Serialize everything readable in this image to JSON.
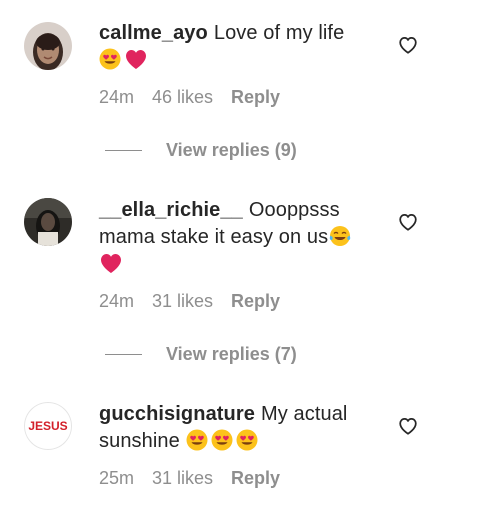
{
  "comments": [
    {
      "username": "callme_ayo",
      "text": "Love of my life",
      "time": "24m",
      "likes": "46 likes",
      "reply_label": "Reply",
      "view_replies": "View replies (9)"
    },
    {
      "username": "__ella_richie__",
      "text": "Oooppsss mama stake it easy on us",
      "time": "24m",
      "likes": "31 likes",
      "reply_label": "Reply",
      "view_replies": "View replies (7)"
    },
    {
      "username": "gucchisignature",
      "text": "My actual sunshine",
      "time": "25m",
      "likes": "31 likes",
      "reply_label": "Reply"
    }
  ],
  "avatar_text": {
    "gucchisignature": "JESUS"
  },
  "icons": {
    "like": "heart-outline-icon",
    "heart_eyes": "heart-eyes-emoji",
    "red_heart": "red-heart-emoji",
    "laughing": "tears-of-joy-emoji"
  },
  "colors": {
    "text": "#262626",
    "secondary": "#8e8e8e",
    "heart": "#e0245e",
    "emoji_yellow": "#fcc21b",
    "jesus_red": "#d3202a"
  }
}
